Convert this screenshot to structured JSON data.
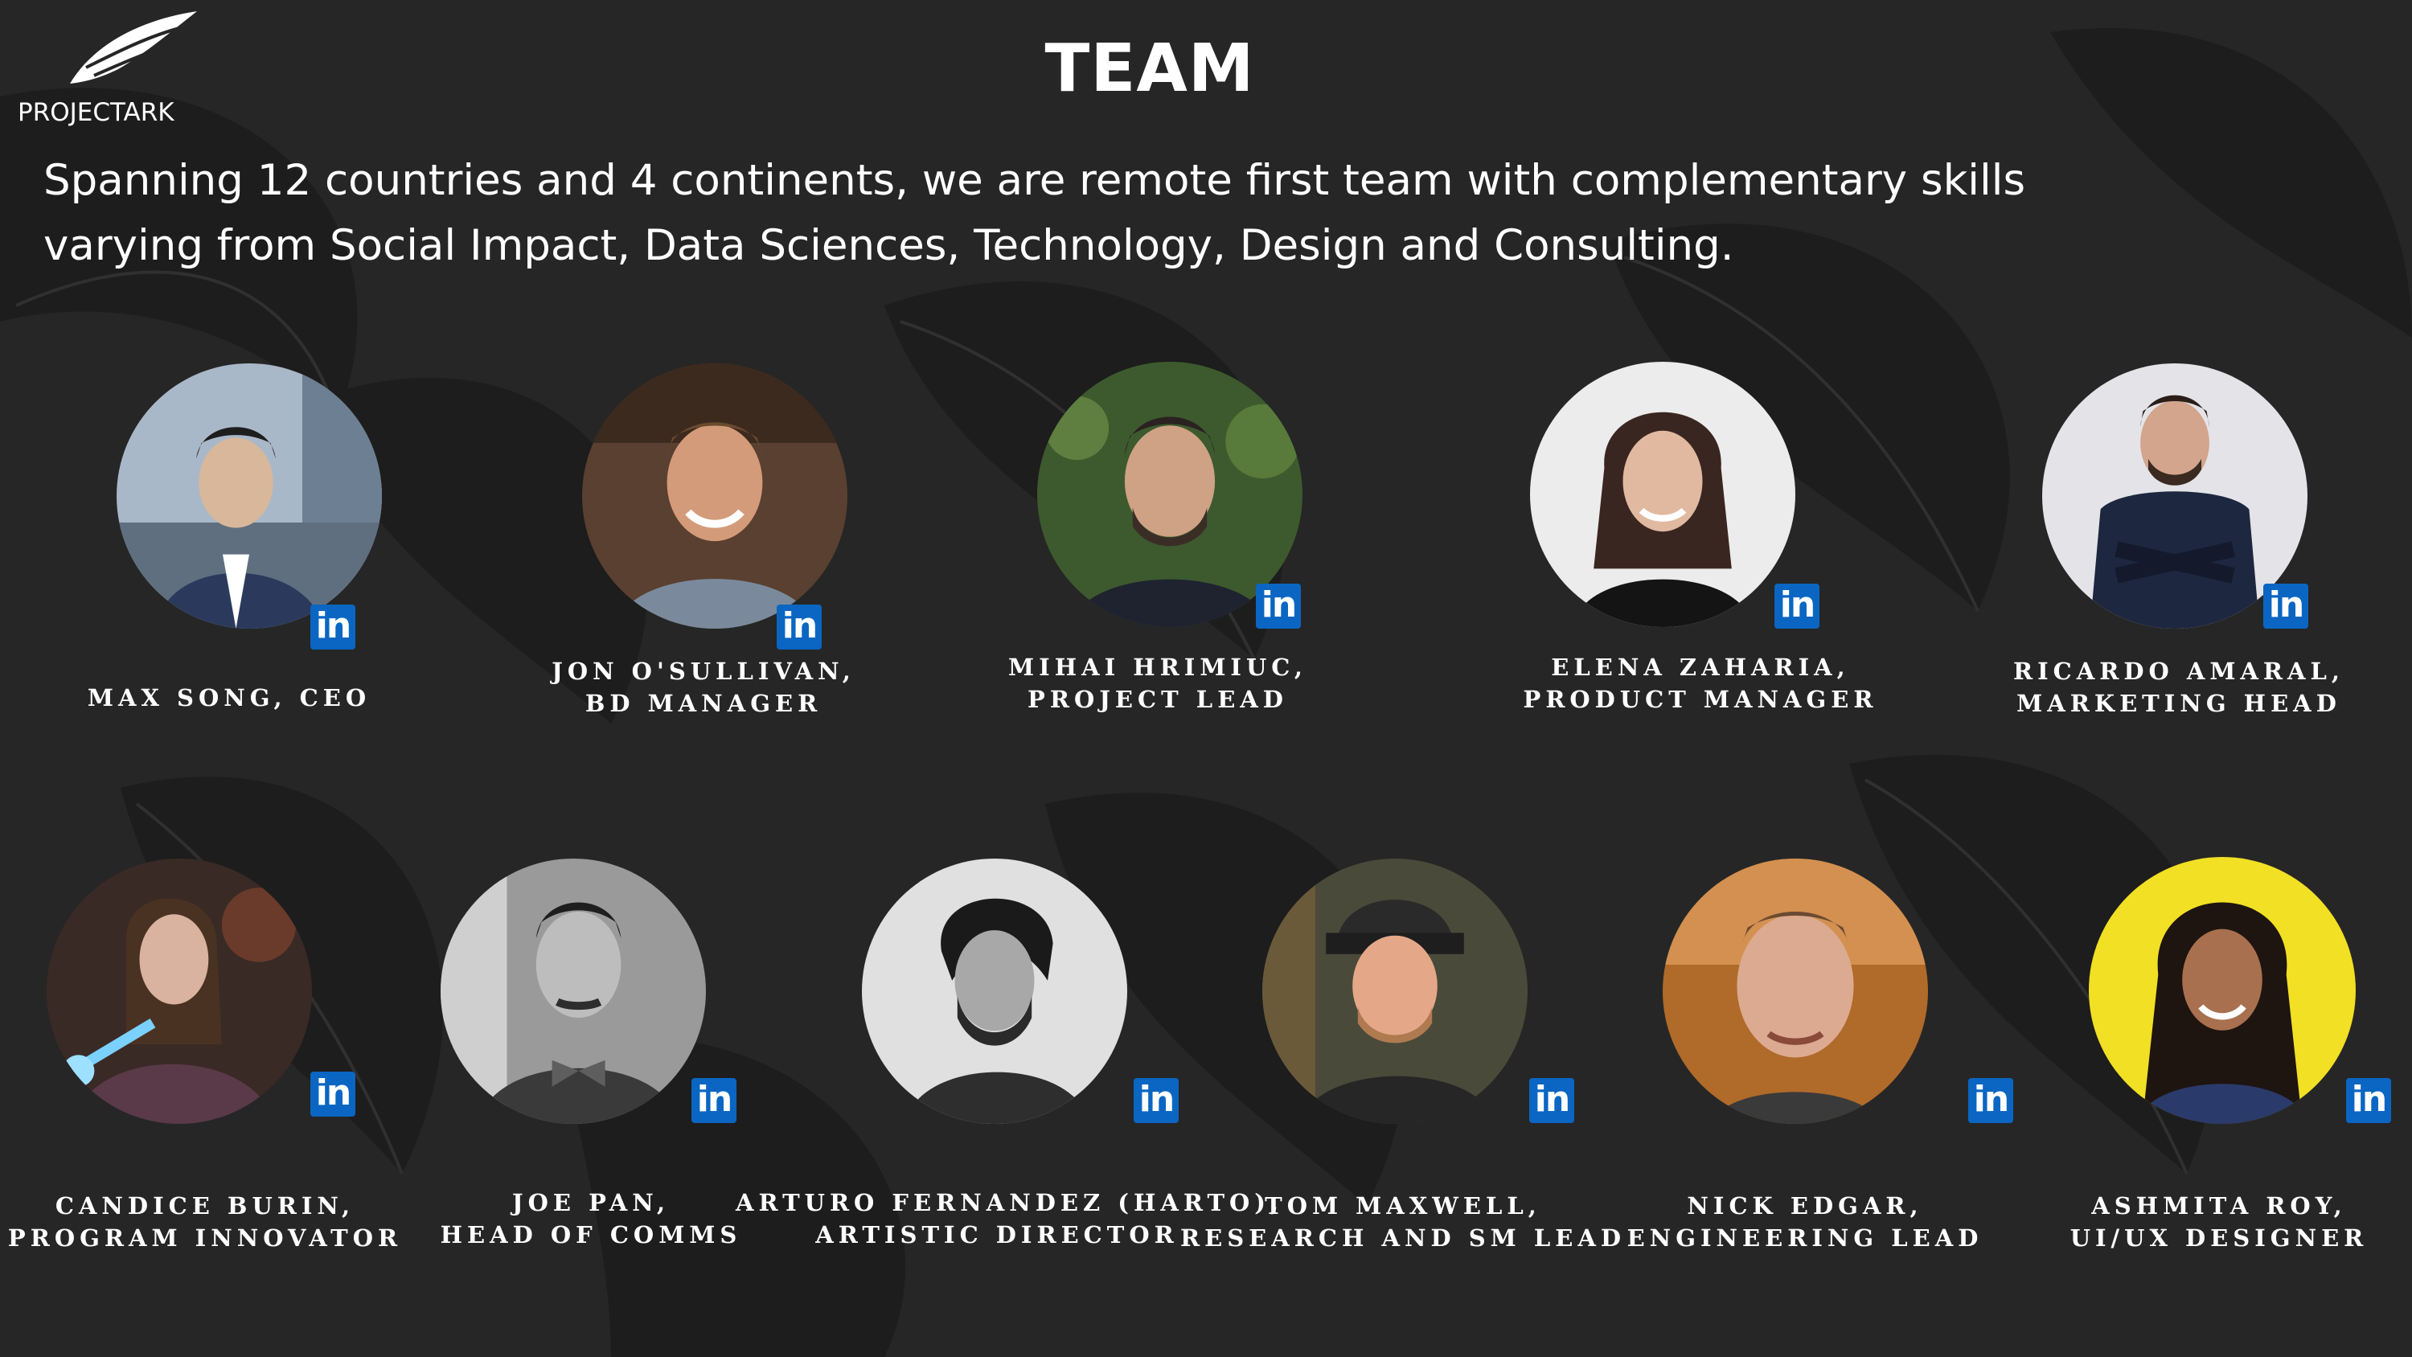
{
  "brand": {
    "name": "PROJECTARK",
    "logo_icon": "wing-logo-icon"
  },
  "page": {
    "title": "TEAM",
    "intro_lines": [
      "Spanning 12 countries and 4 continents, we are remote first team with complementary skills",
      "varying from Social Impact, Data Sciences, Technology, Design and Consulting."
    ]
  },
  "linkedin_icon": {
    "label": "in",
    "color": "#0a66c2"
  },
  "colors": {
    "background": "#262626",
    "text": "#ffffff",
    "linkedin": "#0a66c2"
  },
  "team": [
    {
      "name_line": "MAX SONG, CEO",
      "role_line": ""
    },
    {
      "name_line": "JON O'SULLIVAN,",
      "role_line": "BD MANAGER"
    },
    {
      "name_line": "MIHAI HRIMIUC,",
      "role_line": "PROJECT LEAD"
    },
    {
      "name_line": "ELENA ZAHARIA,",
      "role_line": "PRODUCT MANAGER"
    },
    {
      "name_line": "RICARDO AMARAL,",
      "role_line": "MARKETING HEAD"
    },
    {
      "name_line": "CANDICE BURIN,",
      "role_line": "PROGRAM INNOVATOR"
    },
    {
      "name_line": "JOE PAN,",
      "role_line": "HEAD OF COMMS"
    },
    {
      "name_line": "ARTURO FERNANDEZ (HARTO),",
      "role_line": "ARTISTIC DIRECTOR"
    },
    {
      "name_line": "TOM MAXWELL,",
      "role_line": "RESEARCH AND SM LEAD"
    },
    {
      "name_line": "NICK EDGAR,",
      "role_line": "ENGINEERING LEAD"
    },
    {
      "name_line": "ASHMITA ROY,",
      "role_line": "UI/UX DESIGNER"
    }
  ]
}
